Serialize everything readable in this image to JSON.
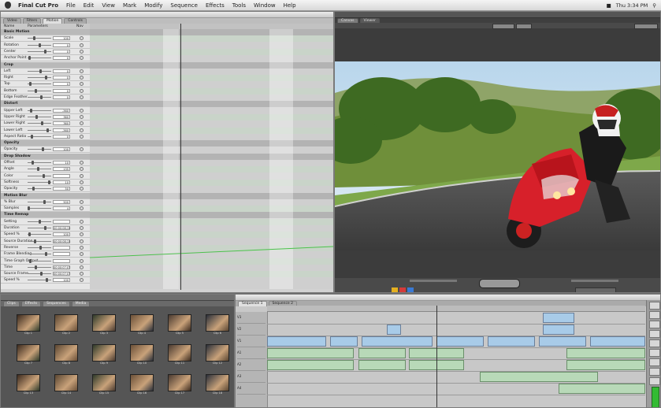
{
  "menubar": {
    "app": "Final Cut Pro",
    "items": [
      "File",
      "Edit",
      "View",
      "Mark",
      "Modify",
      "Sequence",
      "Effects",
      "Tools",
      "Window",
      "Help"
    ],
    "clock": "Thu 3:34 PM"
  },
  "viewer": {
    "tabs": [
      "Video",
      "Filters",
      "Motion",
      "Controls"
    ],
    "columns": {
      "name": "Name",
      "params": "Parameters",
      "nav": "Nav"
    },
    "rows": [
      {
        "label": "Basic Motion",
        "type": "section"
      },
      {
        "label": "Scale",
        "type": "param",
        "value": "100"
      },
      {
        "label": "Rotation",
        "type": "param",
        "value": "0"
      },
      {
        "label": "Center",
        "type": "param",
        "value": "0"
      },
      {
        "label": "Anchor Point",
        "type": "param",
        "value": "0"
      },
      {
        "label": "Crop",
        "type": "section"
      },
      {
        "label": "Left",
        "type": "param",
        "value": "0"
      },
      {
        "label": "Right",
        "type": "param",
        "value": "0"
      },
      {
        "label": "Top",
        "type": "param",
        "value": "0"
      },
      {
        "label": "Bottom",
        "type": "param",
        "value": "0"
      },
      {
        "label": "Edge Feather",
        "type": "param",
        "value": "0"
      },
      {
        "label": "Distort",
        "type": "section"
      },
      {
        "label": "Upper Left",
        "type": "param",
        "value": "-360"
      },
      {
        "label": "Upper Right",
        "type": "param",
        "value": "360"
      },
      {
        "label": "Lower Right",
        "type": "param",
        "value": "360"
      },
      {
        "label": "Lower Left",
        "type": "param",
        "value": "-360"
      },
      {
        "label": "Aspect Ratio",
        "type": "param",
        "value": "0"
      },
      {
        "label": "Opacity",
        "type": "section"
      },
      {
        "label": "Opacity",
        "type": "param",
        "value": "100"
      },
      {
        "label": "Drop Shadow",
        "type": "section"
      },
      {
        "label": "Offset",
        "type": "param",
        "value": "10"
      },
      {
        "label": "Angle",
        "type": "param",
        "value": "135"
      },
      {
        "label": "Color",
        "type": "param",
        "value": ""
      },
      {
        "label": "Softness",
        "type": "param",
        "value": "10"
      },
      {
        "label": "Opacity",
        "type": "param",
        "value": "50"
      },
      {
        "label": "Motion Blur",
        "type": "section"
      },
      {
        "label": "% Blur",
        "type": "param",
        "value": "500"
      },
      {
        "label": "Samples",
        "type": "param",
        "value": "4"
      },
      {
        "label": "Time Remap",
        "type": "section"
      },
      {
        "label": "Setting",
        "type": "param",
        "value": ""
      },
      {
        "label": "Duration",
        "type": "param",
        "value": "00:00:08;15"
      },
      {
        "label": "Speed %",
        "type": "param",
        "value": "100"
      },
      {
        "label": "Source Duration",
        "type": "param",
        "value": "00:00:08;15"
      },
      {
        "label": "Reverse",
        "type": "param",
        "value": ""
      },
      {
        "label": "Frame Blending",
        "type": "param",
        "value": ""
      },
      {
        "label": "Time Graph Output",
        "type": "param",
        "value": ""
      },
      {
        "label": "Time",
        "type": "param",
        "value": "00:00:07;07"
      },
      {
        "label": "Source Frame",
        "type": "param",
        "value": "00:00:07;07"
      },
      {
        "label": "Speed %",
        "type": "param",
        "value": "100"
      }
    ]
  },
  "canvas": {
    "tabs": [
      "Canvas",
      "Viewer"
    ],
    "scene": "red sport motorcycle leaning into a curve on a country road"
  },
  "browser": {
    "tabs": [
      "Clips",
      "Effects",
      "Sequences",
      "Media"
    ],
    "clips": [
      "Clip 1",
      "Clip 2",
      "Clip 3",
      "Clip 4",
      "Clip 5",
      "Clip 6",
      "Clip 7",
      "Clip 8",
      "Clip 9",
      "Clip 10",
      "Clip 11",
      "Clip 12",
      "Clip 13",
      "Clip 14",
      "Clip 15",
      "Clip 16",
      "Clip 17",
      "Clip 18"
    ]
  },
  "timeline": {
    "tabs": [
      "Sequence 1",
      "Sequence 2"
    ],
    "video_tracks": [
      "V3",
      "V2",
      "V1"
    ],
    "audio_tracks": [
      "A1",
      "A2",
      "A3",
      "A4"
    ]
  },
  "colors": {
    "video_clip": "#a8cbe8",
    "audio_clip": "#b8d9b8",
    "motorcycle": "#d7202a"
  }
}
